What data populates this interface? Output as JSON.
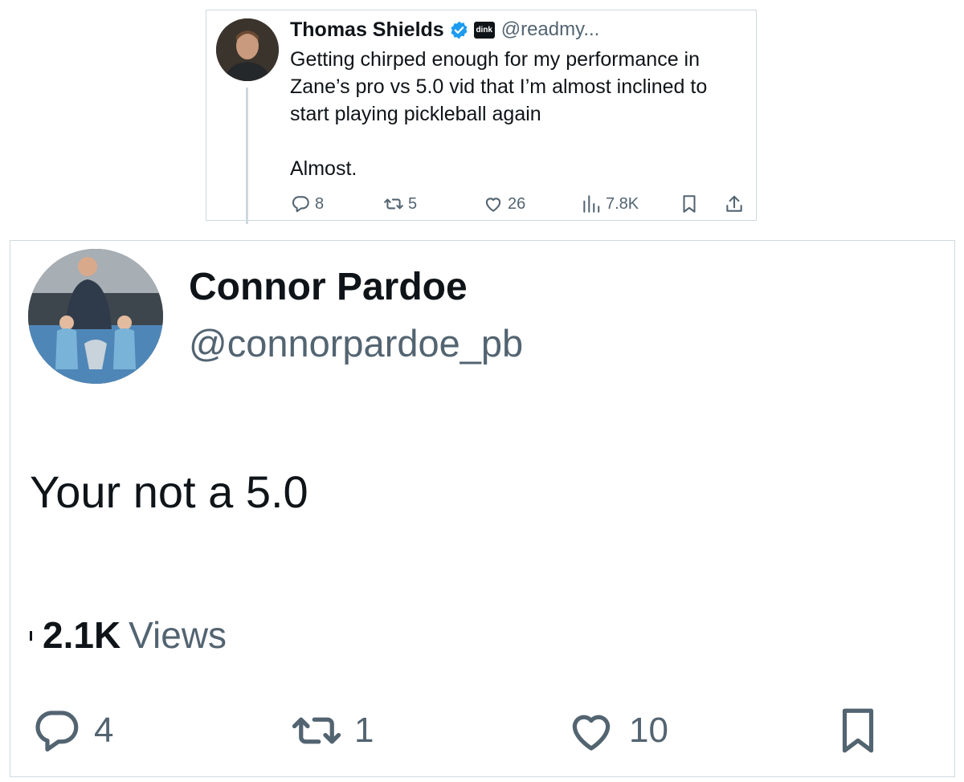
{
  "quoted_tweet": {
    "author_name": "Thomas Shields",
    "affiliate_badge": "dink",
    "handle": "@readmy...",
    "text": "Getting chirped enough for my performance in Zane’s pro vs 5.0 vid that I’m almost inclined to start playing pickleball again\n\nAlmost.",
    "replies": "8",
    "reposts": "5",
    "likes": "26",
    "views": "7.8K"
  },
  "reply_tweet": {
    "author_name": "Connor Pardoe",
    "handle": "@connorpardoe_pb",
    "text": "Your not a 5.0",
    "views_count": "2.1K",
    "views_label": "Views",
    "replies": "4",
    "reposts": "1",
    "likes": "10"
  },
  "colors": {
    "text": "#0f1419",
    "secondary": "#536471",
    "verified": "#1d9bf0",
    "border": "#cfd9de"
  },
  "icons": [
    "reply-icon",
    "repost-icon",
    "like-icon",
    "views-icon",
    "bookmark-icon",
    "share-icon",
    "verified-badge-icon"
  ]
}
